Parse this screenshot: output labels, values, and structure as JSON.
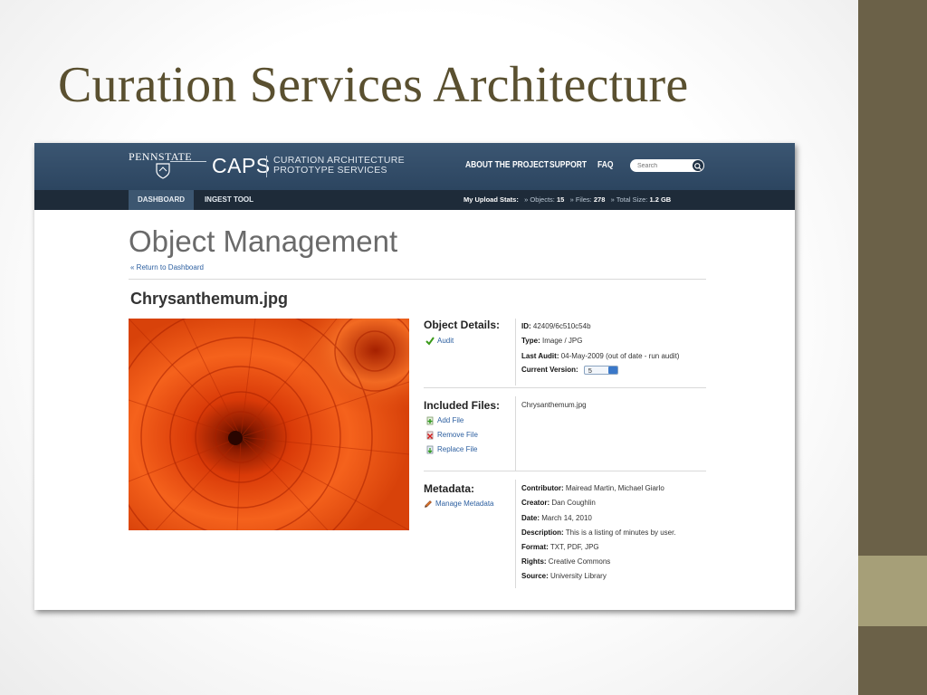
{
  "slide": {
    "title": "Curation Services Architecture",
    "colors": {
      "title": "#5a5030",
      "side_bar": "#6b6148",
      "side_accent": "#a69f78"
    }
  },
  "app": {
    "brand": {
      "org": "PENNSTATE",
      "name": "CAPS",
      "subtitle_1": "CURATION ARCHITECTURE",
      "subtitle_2": "PROTOTYPE SERVICES"
    },
    "nav": [
      "ABOUT THE PROJECT",
      "SUPPORT",
      "FAQ"
    ],
    "search": {
      "placeholder": "Search",
      "icon": "search-icon"
    },
    "tabs": [
      {
        "label": "DASHBOARD",
        "active": true
      },
      {
        "label": "INGEST TOOL",
        "active": false
      }
    ],
    "upload_stats": {
      "label": "My Upload Stats:",
      "objects_label": "» Objects:",
      "objects": "15",
      "files_label": "» Files:",
      "files": "278",
      "size_label": "» Total Size:",
      "size": "1.2 GB"
    },
    "colors": {
      "header": "#2c4560",
      "subnav": "#1e2b39",
      "link": "#2c5fa0"
    }
  },
  "page": {
    "title": "Object Management",
    "back_link": "« Return to Dashboard",
    "file_name": "Chrysanthemum.jpg",
    "object_details": {
      "heading": "Object Details:",
      "action": "Audit",
      "id_label": "ID:",
      "id": "42409/6c510c54b",
      "type_label": "Type:",
      "type": "Image / JPG",
      "audit_label": "Last Audit:",
      "audit": "04-May-2009 (out of date - run audit)",
      "version_label": "Current Version:",
      "version": "5"
    },
    "included_files": {
      "heading": "Included Files:",
      "actions": [
        "Add File",
        "Remove File",
        "Replace File"
      ],
      "files": [
        "Chrysanthemum.jpg"
      ]
    },
    "metadata": {
      "heading": "Metadata:",
      "action": "Manage Metadata",
      "fields": [
        {
          "label": "Contributor:",
          "value": "Mairead Martin, Michael Giarlo"
        },
        {
          "label": "Creator:",
          "value": "Dan Coughlin"
        },
        {
          "label": "Date:",
          "value": "March 14, 2010"
        },
        {
          "label": "Description:",
          "value": "This is a listing of minutes by user."
        },
        {
          "label": "Format:",
          "value": "TXT, PDF, JPG"
        },
        {
          "label": "Rights:",
          "value": "Creative Commons"
        },
        {
          "label": "Source:",
          "value": "University Library"
        }
      ]
    }
  }
}
